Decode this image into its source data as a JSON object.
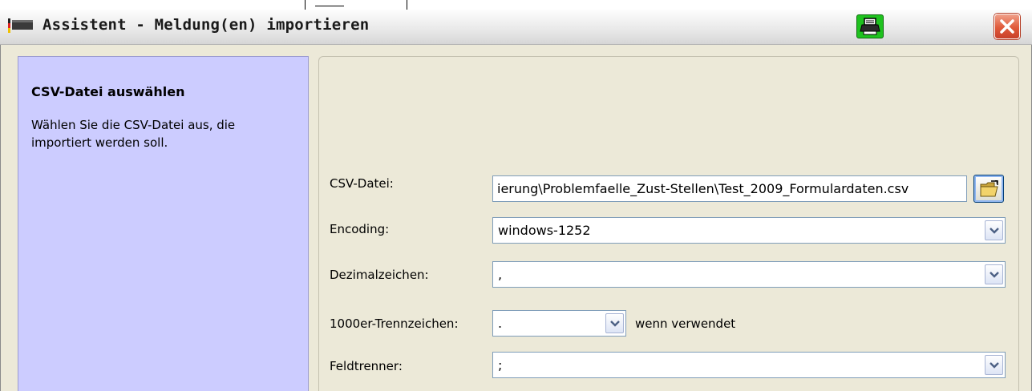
{
  "window": {
    "title": "Assistent - Meldung(en) importieren",
    "icons": {
      "app": "flag-icon",
      "print": "printer-icon",
      "close": "close-icon",
      "browse": "folder-open-icon",
      "dropdown": "chevron-down-icon"
    },
    "colors": {
      "accent_left_panel": "#ccccff",
      "print_button": "#1fc21f",
      "close_button": "#e05a3a"
    }
  },
  "left_panel": {
    "title": "CSV-Datei auswählen",
    "description": "Wählen Sie die CSV-Datei aus, die importiert werden soll."
  },
  "form": {
    "csv_file": {
      "label": "CSV-Datei:",
      "value": "ierung\\Problemfaelle_Zust-Stellen\\Test_2009_Formulardaten.csv"
    },
    "encoding": {
      "label": "Encoding:",
      "value": "windows-1252"
    },
    "decimal_separator": {
      "label": "Dezimalzeichen:",
      "value": ","
    },
    "thousands_separator": {
      "label": "1000er-Trennzeichen:",
      "value": ".",
      "hint": "wenn verwendet"
    },
    "field_separator": {
      "label": "Feldtrenner:",
      "value": ";"
    }
  }
}
